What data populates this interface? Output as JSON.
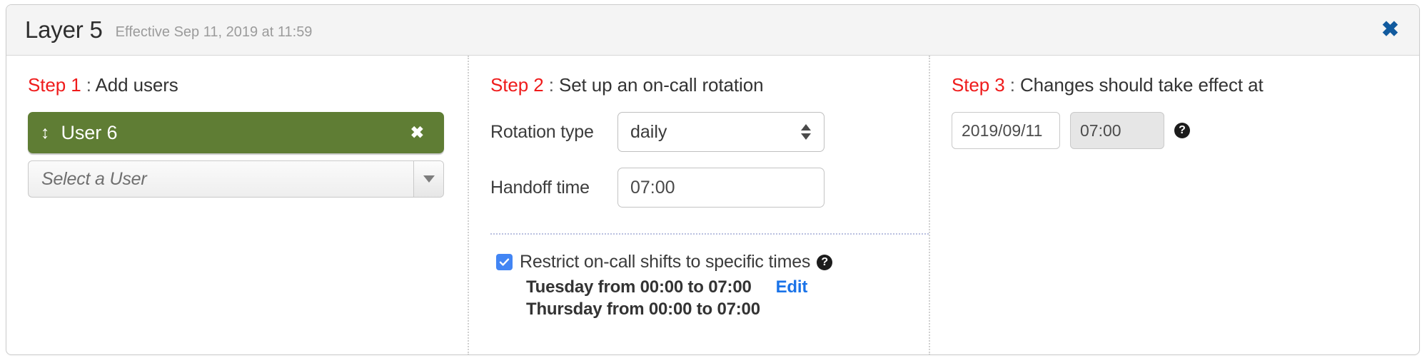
{
  "header": {
    "title": "Layer 5",
    "effective": "Effective Sep 11, 2019 at 11:59",
    "close_icon": "close-icon",
    "close_glyph": "✖"
  },
  "step1": {
    "step_label": "Step 1",
    "separator": " : ",
    "heading": "Add users",
    "user_chip": {
      "drag_glyph": "↕",
      "label": "User 6",
      "remove_glyph": "✖",
      "color": "#5f7d34"
    },
    "user_select": {
      "value": "Select a User",
      "arrow_icon": "chevron-down-icon"
    }
  },
  "step2": {
    "step_label": "Step 2",
    "separator": " : ",
    "heading": "Set up an on-call rotation",
    "rotation_type": {
      "label": "Rotation type",
      "value": "daily",
      "options": [
        "daily"
      ]
    },
    "handoff_time": {
      "label": "Handoff time",
      "value": "07:00"
    },
    "restrict": {
      "checked": true,
      "label": "Restrict on-call shifts to specific times",
      "help_glyph": "?",
      "edit_label": "Edit",
      "restrictions": [
        "Tuesday from 00:00 to 07:00",
        "Thursday from 00:00 to 07:00"
      ]
    }
  },
  "step3": {
    "step_label": "Step 3",
    "separator": " : ",
    "heading": "Changes should take effect at",
    "date_value": "2019/09/11",
    "time_value": "07:00",
    "help_glyph": "?"
  },
  "colors": {
    "accent_red": "#ef1b1b",
    "link_blue": "#1a73e8",
    "close_blue": "#115a9e",
    "chip_green": "#5f7d34",
    "checkbox_blue": "#4285f4"
  }
}
